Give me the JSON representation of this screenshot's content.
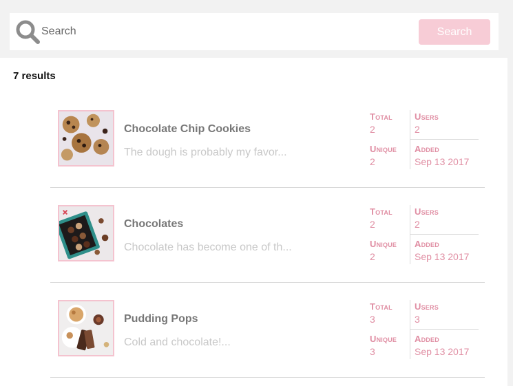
{
  "search": {
    "placeholder": "Search",
    "button_label": "Search"
  },
  "results": {
    "count_label": "7 results",
    "items": [
      {
        "title": "Chocolate Chip Cookies",
        "snippet": "The dough is probably my favor...",
        "total_label": "Total",
        "total": "2",
        "users_label": "Users",
        "users": "2",
        "unique_label": "Unique",
        "unique": "2",
        "added_label": "Added",
        "added": "Sep 13 2017"
      },
      {
        "title": "Chocolates",
        "snippet": "Chocolate has become one of th...",
        "total_label": "Total",
        "total": "2",
        "users_label": "Users",
        "users": "2",
        "unique_label": "Unique",
        "unique": "2",
        "added_label": "Added",
        "added": "Sep 13 2017"
      },
      {
        "title": "Pudding Pops",
        "snippet": "Cold and chocolate!...",
        "total_label": "Total",
        "total": "3",
        "users_label": "Users",
        "users": "3",
        "unique_label": "Unique",
        "unique": "3",
        "added_label": "Added",
        "added": "Sep 13 2017"
      }
    ]
  },
  "colors": {
    "accent": "#e08ea3",
    "button_bg": "#f7ccd6",
    "thumb_border": "#f4c3cf"
  }
}
